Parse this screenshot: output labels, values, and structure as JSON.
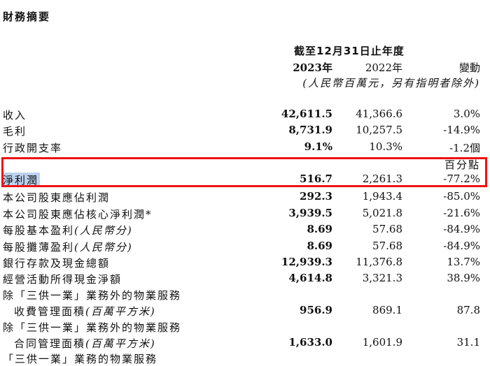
{
  "title": "財務摘要",
  "header": {
    "period": "截至12月31日止年度",
    "year_current": "2023年",
    "year_prior": "2022年",
    "change": "變動",
    "unit_note": "(人民幣百萬元，另有指明者除外)"
  },
  "rows": [
    {
      "label": "收入",
      "v2023": "42,611.5",
      "v2022": "41,366.6",
      "change": "3.0%"
    },
    {
      "label": "毛利",
      "v2023": "8,731.9",
      "v2022": "10,257.5",
      "change": "-14.9%"
    },
    {
      "label": "行政開支率",
      "v2023": "9.1%",
      "v2022": "10.3%",
      "change": "-1.2個"
    },
    {
      "label": "淨利潤",
      "v2023": "516.7",
      "v2022": "2,261.3",
      "change": "-77.2%"
    },
    {
      "label": "本公司股東應佔利潤",
      "v2023": "292.3",
      "v2022": "1,943.4",
      "change": "-85.0%"
    },
    {
      "label": "本公司股東應佔核心淨利潤*",
      "v2023": "3,939.5",
      "v2022": "5,021.8",
      "change": "-21.6%"
    },
    {
      "label": "每股基本盈利",
      "label_suffix": "(人民幣分)",
      "v2023": "8.69",
      "v2022": "57.68",
      "change": "-84.9%"
    },
    {
      "label": "每股攤薄盈利",
      "label_suffix": "(人民幣分)",
      "v2023": "8.69",
      "v2022": "57.68",
      "change": "-84.9%"
    },
    {
      "label": "銀行存款及現金總額",
      "v2023": "12,939.3",
      "v2022": "11,376.8",
      "change": "13.7%"
    },
    {
      "label": "經營活動所得現金淨額",
      "v2023": "4,614.8",
      "v2022": "3,321.3",
      "change": "38.9%"
    },
    {
      "label": "除「三供一業」業務外的物業服務"
    },
    {
      "label": "收費管理面積",
      "label_suffix": "(百萬平方米)",
      "v2023": "956.9",
      "v2022": "869.1",
      "change": "87.8"
    },
    {
      "label": "除「三供一業」業務外的物業服務"
    },
    {
      "label": "合同管理面積",
      "label_suffix": "(百萬平方米)",
      "v2023": "1,633.0",
      "v2022": "1,601.9",
      "change": "31.1"
    },
    {
      "label": "「三供一業」業務的物業服務"
    }
  ],
  "change_unit_note": "百分點",
  "colors": {
    "highlight_box": "#ee1111",
    "text_selection": "#bcd3ee"
  }
}
